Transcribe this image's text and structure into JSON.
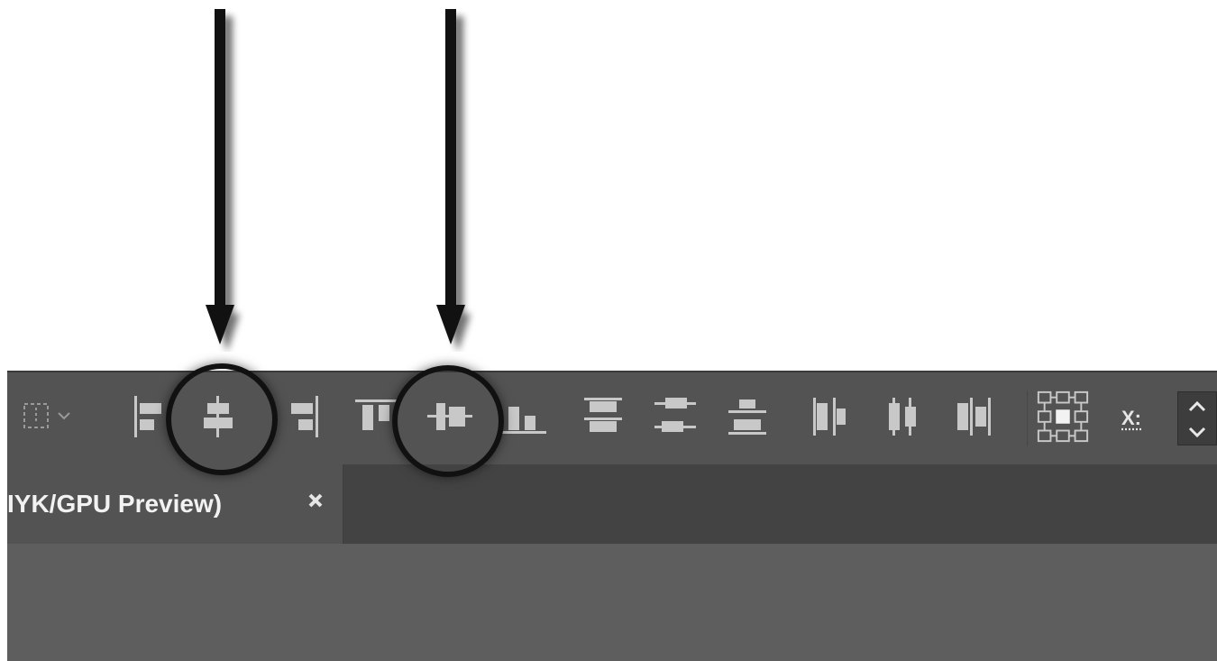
{
  "document_tab": {
    "title": "IYK/GPU Preview)",
    "close_glyph": "✖"
  },
  "toolbar": {
    "tools": [
      {
        "name": "transform-panel-dropdown-icon"
      },
      {
        "name": "horizontal-align-left-icon"
      },
      {
        "name": "horizontal-align-center-icon"
      },
      {
        "name": "horizontal-align-right-icon"
      },
      {
        "name": "vertical-align-top-icon"
      },
      {
        "name": "vertical-align-center-icon"
      },
      {
        "name": "vertical-align-bottom-icon"
      },
      {
        "name": "vertical-distribute-top-icon"
      },
      {
        "name": "vertical-distribute-center-icon"
      },
      {
        "name": "vertical-distribute-bottom-icon"
      },
      {
        "name": "horizontal-distribute-left-icon"
      },
      {
        "name": "horizontal-distribute-center-icon"
      },
      {
        "name": "horizontal-distribute-right-icon"
      },
      {
        "name": "reference-point-icon"
      }
    ],
    "x_label": "X:"
  },
  "annotations": {
    "highlighted": [
      "horizontal-align-center-icon",
      "vertical-align-center-icon"
    ]
  },
  "colors": {
    "toolbar_bg": "#535353",
    "icon_fill": "#c8c8c8",
    "annotation": "#111111"
  }
}
